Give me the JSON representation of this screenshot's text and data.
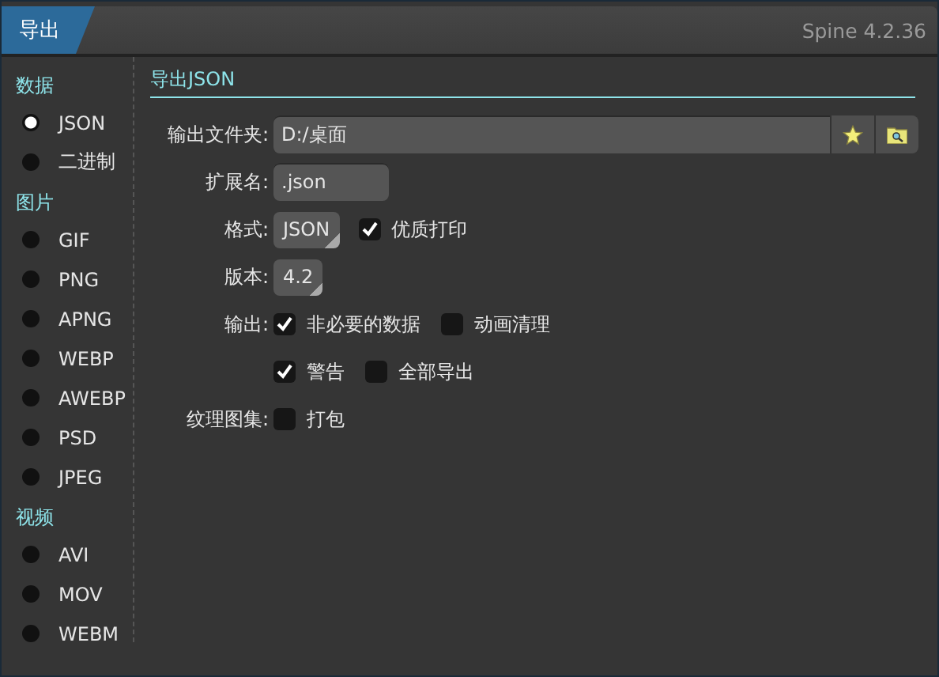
{
  "window": {
    "tab": "导出",
    "version": "Spine 4.2.36"
  },
  "sidebar": [
    {
      "heading": "数据",
      "items": [
        {
          "label": "JSON",
          "selected": true
        },
        {
          "label": "二进制",
          "selected": false
        }
      ]
    },
    {
      "heading": "图片",
      "items": [
        {
          "label": "GIF",
          "selected": false
        },
        {
          "label": "PNG",
          "selected": false
        },
        {
          "label": "APNG",
          "selected": false
        },
        {
          "label": "WEBP",
          "selected": false
        },
        {
          "label": "AWEBP",
          "selected": false
        },
        {
          "label": "PSD",
          "selected": false
        },
        {
          "label": "JPEG",
          "selected": false
        }
      ]
    },
    {
      "heading": "视频",
      "items": [
        {
          "label": "AVI",
          "selected": false
        },
        {
          "label": "MOV",
          "selected": false
        },
        {
          "label": "WEBM",
          "selected": false
        }
      ]
    }
  ],
  "panel": {
    "title": "导出JSON",
    "rows": [
      {
        "kind": "folder",
        "label": "输出文件夹:",
        "value": "D:/桌面"
      },
      {
        "kind": "text",
        "label": "扩展名:",
        "value": ".json"
      },
      {
        "kind": "select",
        "label": "格式:",
        "value": "JSON",
        "checks": [
          {
            "label": "优质打印",
            "checked": true
          }
        ]
      },
      {
        "kind": "select",
        "label": "版本:",
        "value": "4.2",
        "checks": []
      },
      {
        "kind": "checks",
        "label": "输出:",
        "checks": [
          {
            "label": "非必要的数据",
            "checked": true
          },
          {
            "label": "动画清理",
            "checked": false
          }
        ]
      },
      {
        "kind": "checks",
        "label": "",
        "checks": [
          {
            "label": "警告",
            "checked": true
          },
          {
            "label": "全部导出",
            "checked": false
          }
        ]
      },
      {
        "kind": "checks",
        "label": "纹理图集:",
        "checks": [
          {
            "label": "打包",
            "checked": false
          }
        ]
      }
    ]
  }
}
